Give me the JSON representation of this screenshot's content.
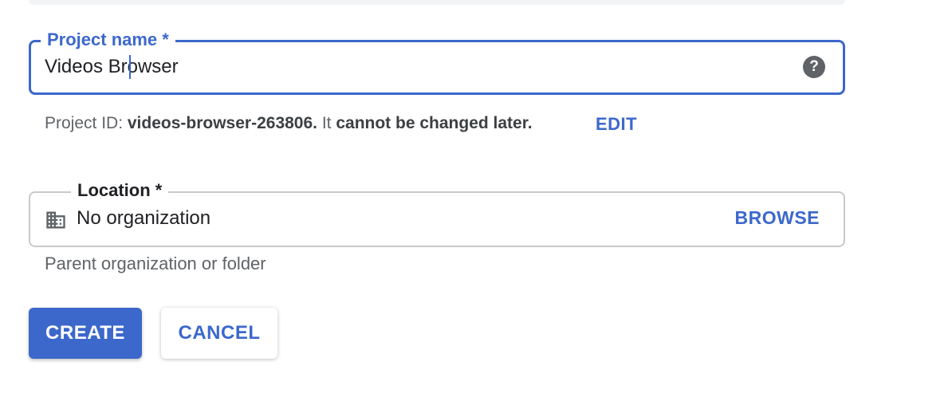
{
  "project_field": {
    "label": "Project name *",
    "value": "Videos Browser",
    "help_icon": "help-question-icon"
  },
  "project_id": {
    "prefix": "Project ID: ",
    "id": "videos-browser-263806.",
    "middle": " It ",
    "suffix": "cannot be changed later.",
    "edit_label": "EDIT"
  },
  "location_field": {
    "label": "Location *",
    "icon": "building-icon",
    "value": "No organization",
    "browse_label": "BROWSE",
    "helper": "Parent organization or folder"
  },
  "actions": {
    "create_label": "CREATE",
    "cancel_label": "CANCEL"
  },
  "colors": {
    "accent": "#3c68cc",
    "muted_text": "#5f6368",
    "border": "#c8c9cc"
  }
}
